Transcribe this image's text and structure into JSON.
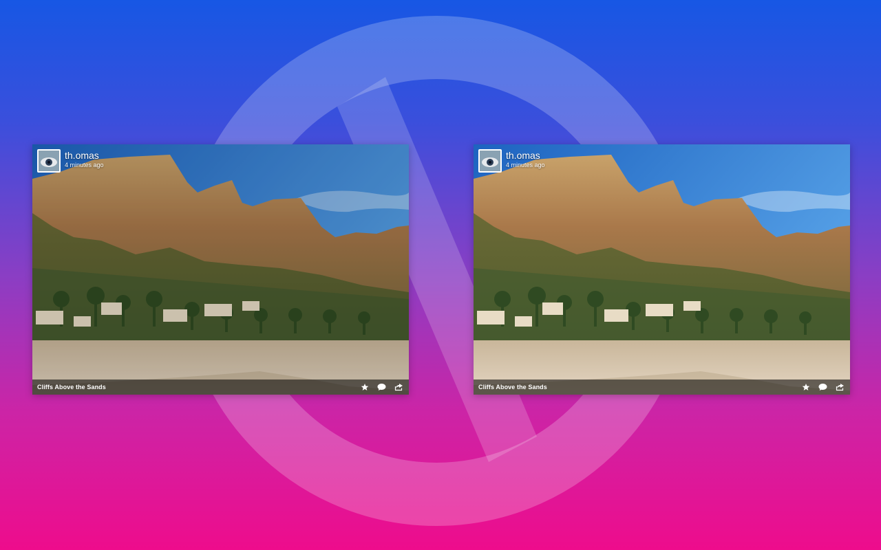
{
  "colors": {
    "bg_top": "#1757e4",
    "bg_bottom": "#ee0c8c",
    "symbol": "#ffffff",
    "footer_bar": "#000000"
  },
  "cards": [
    {
      "variant": "original",
      "author": {
        "username": "th.omas",
        "avatar_icon": "avatar-image"
      },
      "posted": "4 minutes ago",
      "caption": "Cliffs Above the Sands",
      "actions": [
        "star-icon",
        "comment-icon",
        "share-icon"
      ]
    },
    {
      "variant": "enhanced",
      "author": {
        "username": "th.omas",
        "avatar_icon": "avatar-image"
      },
      "posted": "4 minutes ago",
      "caption": "Cliffs Above the Sands",
      "actions": [
        "star-icon",
        "comment-icon",
        "share-icon"
      ]
    }
  ]
}
